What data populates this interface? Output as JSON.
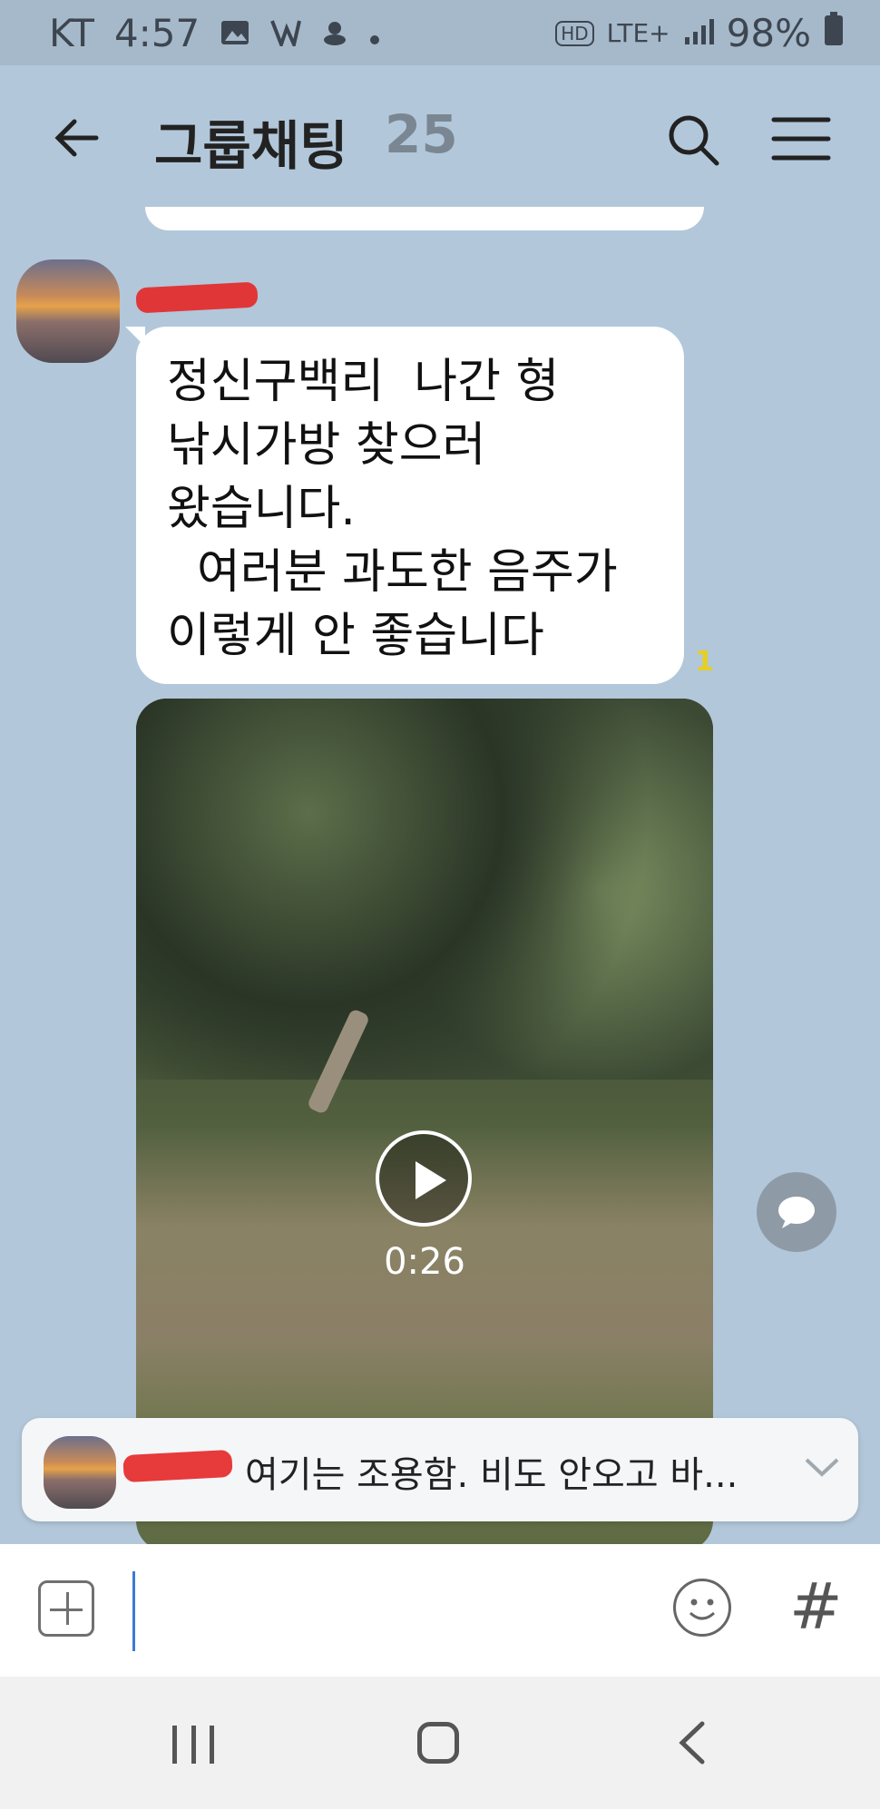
{
  "status_bar": {
    "carrier": "KT",
    "time": "4:57",
    "network": "LTE+",
    "hd_label": "HD",
    "battery": "98%"
  },
  "header": {
    "title": "그룹채팅",
    "member_count": "25"
  },
  "messages": [
    {
      "sender": "",
      "lines": [
        "정신구백리  나간 형",
        "낚시가방 찾으러",
        "왔습니다.",
        "  여러분 과도한 음주가",
        "이렇게 안 좋습니다"
      ],
      "unread_count": "1"
    }
  ],
  "video": {
    "duration": "0:26"
  },
  "notice_bar": {
    "text": "여기는 조용함. 비도 안오고 바..."
  },
  "input_bar": {
    "hash_label": "#"
  },
  "colors": {
    "background": "#b2c7da",
    "unread": "#e6cf23",
    "caret": "#3a7bd5"
  }
}
